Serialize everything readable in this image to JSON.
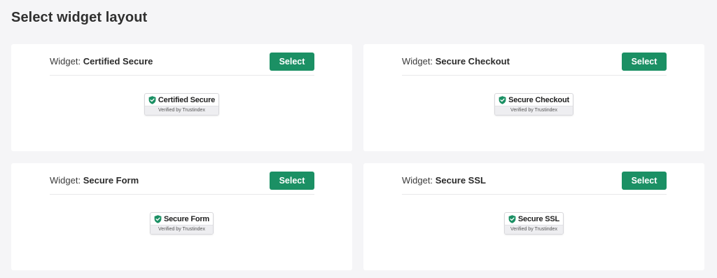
{
  "page": {
    "title": "Select widget layout"
  },
  "colors": {
    "accent": "#1b9064",
    "page_background": "#f5f5f7",
    "card_background": "#ffffff"
  },
  "widgets": [
    {
      "prefix": "Widget:",
      "name": "Certified Secure",
      "button_label": "Select",
      "badge": {
        "icon": "shield-check-icon",
        "title": "Certified Secure",
        "subtitle": "Verified by Trustindex"
      }
    },
    {
      "prefix": "Widget:",
      "name": "Secure Checkout",
      "button_label": "Select",
      "badge": {
        "icon": "shield-check-icon",
        "title": "Secure Checkout",
        "subtitle": "Verified by Trustindex"
      }
    },
    {
      "prefix": "Widget:",
      "name": "Secure Form",
      "button_label": "Select",
      "badge": {
        "icon": "shield-check-icon",
        "title": "Secure Form",
        "subtitle": "Verified by Trustindex"
      }
    },
    {
      "prefix": "Widget:",
      "name": "Secure SSL",
      "button_label": "Select",
      "badge": {
        "icon": "shield-check-icon",
        "title": "Secure SSL",
        "subtitle": "Verified by Trustindex"
      }
    }
  ]
}
